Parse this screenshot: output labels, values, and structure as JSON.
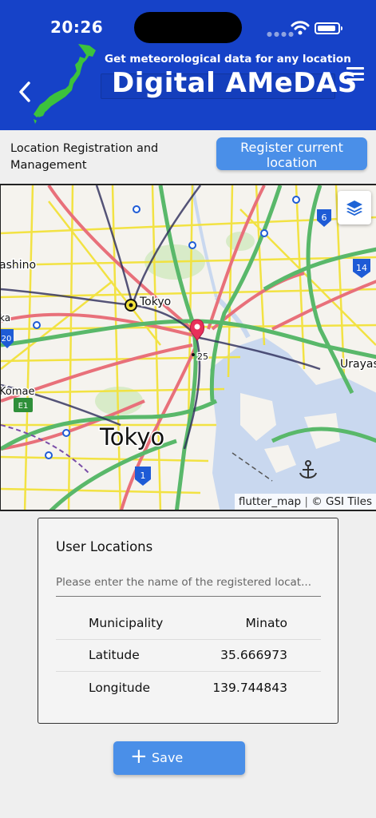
{
  "status_bar": {
    "time": "20:26"
  },
  "header": {
    "tagline": "Get meteorological data for any location",
    "title": "Digital AMeDAS"
  },
  "registration": {
    "label": "Location Registration and Management",
    "button_label": "Register current location"
  },
  "map": {
    "labels": {
      "tokyo_station": "Tokyo",
      "tokyo_big": "Tokyo",
      "shino": "ashino",
      "urayasu": "Urayas",
      "komae": "Komae",
      "route_25": "25",
      "ka": "ka"
    },
    "shields": {
      "r6": "6",
      "r14": "14",
      "r20": "20",
      "r1": "1",
      "e1": "E1"
    },
    "attribution": {
      "lib": "flutter_map",
      "sep": "|",
      "tiles": "© GSI Tiles"
    },
    "icons": [
      "layers-icon",
      "location-pin-icon",
      "anchor-icon"
    ]
  },
  "card": {
    "title": "User Locations",
    "input_placeholder": "Please enter the name of the registered locat...",
    "rows": [
      {
        "key": "Municipality",
        "value": "Minato"
      },
      {
        "key": "Latitude",
        "value": "35.666973"
      },
      {
        "key": "Longitude",
        "value": "139.744843"
      }
    ]
  },
  "save_button": {
    "label": "Save"
  },
  "colors": {
    "header": "#1642c8",
    "button": "#4a8fe8",
    "pin": "#e8305a",
    "water": "#c9d8ef"
  }
}
